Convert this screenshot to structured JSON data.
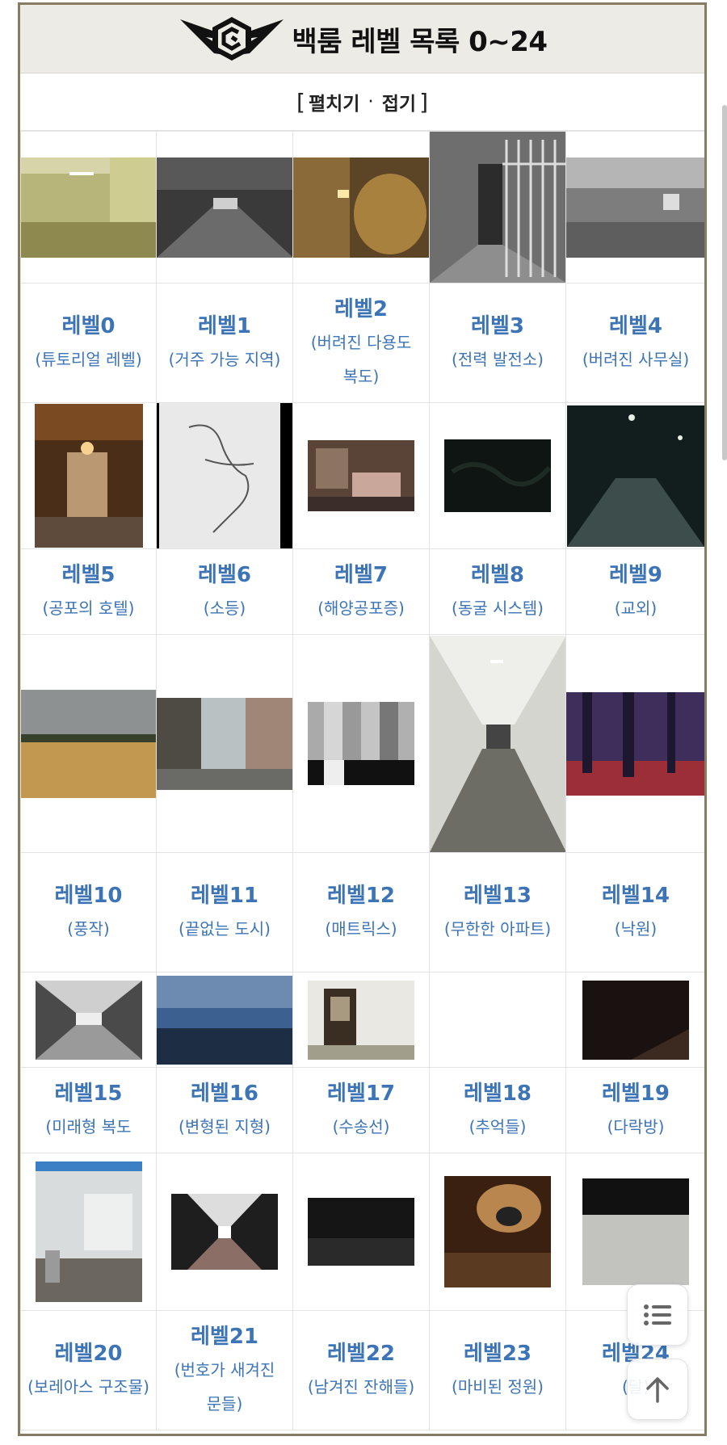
{
  "header": {
    "title": "백룸 레벨 목록 0~24",
    "emblem_icon": "winged-shield-emblem"
  },
  "fold": {
    "open_bracket": "[",
    "expand_label": "펼치기",
    "separator": "·",
    "collapse_label": "접기",
    "close_bracket": "]"
  },
  "levels": [
    {
      "name": "레벨0",
      "sub": "(튜토리얼 레벨)",
      "image": "empty yellow office room"
    },
    {
      "name": "레벨1",
      "sub": "(거주 가능 지역)",
      "image": "dark parking garage"
    },
    {
      "name": "레벨2",
      "sub": "(버려진 다용도 복도)",
      "image": "narrow pipe corridor"
    },
    {
      "name": "레벨3",
      "sub": "(전력 발전소)",
      "image": "barred gate hallway"
    },
    {
      "name": "레벨4",
      "sub": "(버려진 사무실)",
      "image": "empty office floor"
    },
    {
      "name": "레벨5",
      "sub": "(공포의 호텔)",
      "image": "ornate hotel lobby"
    },
    {
      "name": "레벨6",
      "sub": "(소등)",
      "image": "hand-drawn map"
    },
    {
      "name": "레벨7",
      "sub": "(해양공포증)",
      "image": "flooded room"
    },
    {
      "name": "레벨8",
      "sub": "(동굴 시스템)",
      "image": "dark cave"
    },
    {
      "name": "레벨9",
      "sub": "(교외)",
      "image": "night suburb street"
    },
    {
      "name": "레벨10",
      "sub": "(풍작)",
      "image": "wheat field"
    },
    {
      "name": "레벨11",
      "sub": "(끝없는 도시)",
      "image": "city street"
    },
    {
      "name": "레벨12",
      "sub": "(매트릭스)",
      "image": "gray test pattern"
    },
    {
      "name": "레벨13",
      "sub": "(무한한 아파트)",
      "image": "long apartment hallway"
    },
    {
      "name": "레벨14",
      "sub": "(낙원)",
      "image": "red forest"
    },
    {
      "name": "레벨15",
      "sub": "(미래형 복도",
      "image": "futuristic corridor"
    },
    {
      "name": "레벨16",
      "sub": "(변형된 지형)",
      "image": "blue misty landscape"
    },
    {
      "name": "레벨17",
      "sub": "(수송선)",
      "image": "ship room"
    },
    {
      "name": "레벨18",
      "sub": "(추억들)",
      "image": ""
    },
    {
      "name": "레벨19",
      "sub": "(다락방)",
      "image": "dark attic"
    },
    {
      "name": "레벨20",
      "sub": "(보레아스 구조물)",
      "image": "locker room"
    },
    {
      "name": "레벨21",
      "sub": "(번호가 새겨진 문들)",
      "image": "hotel corridor"
    },
    {
      "name": "레벨22",
      "sub": "(남겨진 잔해들)",
      "image": "dark garage"
    },
    {
      "name": "레벨23",
      "sub": "(마비된 정원)",
      "image": "plush toy"
    },
    {
      "name": "레벨24",
      "sub": "(달)",
      "image": "moon surface"
    }
  ],
  "floating": {
    "toc_icon": "list-icon",
    "top_icon": "arrow-up-icon"
  },
  "colors": {
    "link": "#3d74b5",
    "frame_border": "#857c61",
    "title_bg": "#ecebe6"
  }
}
